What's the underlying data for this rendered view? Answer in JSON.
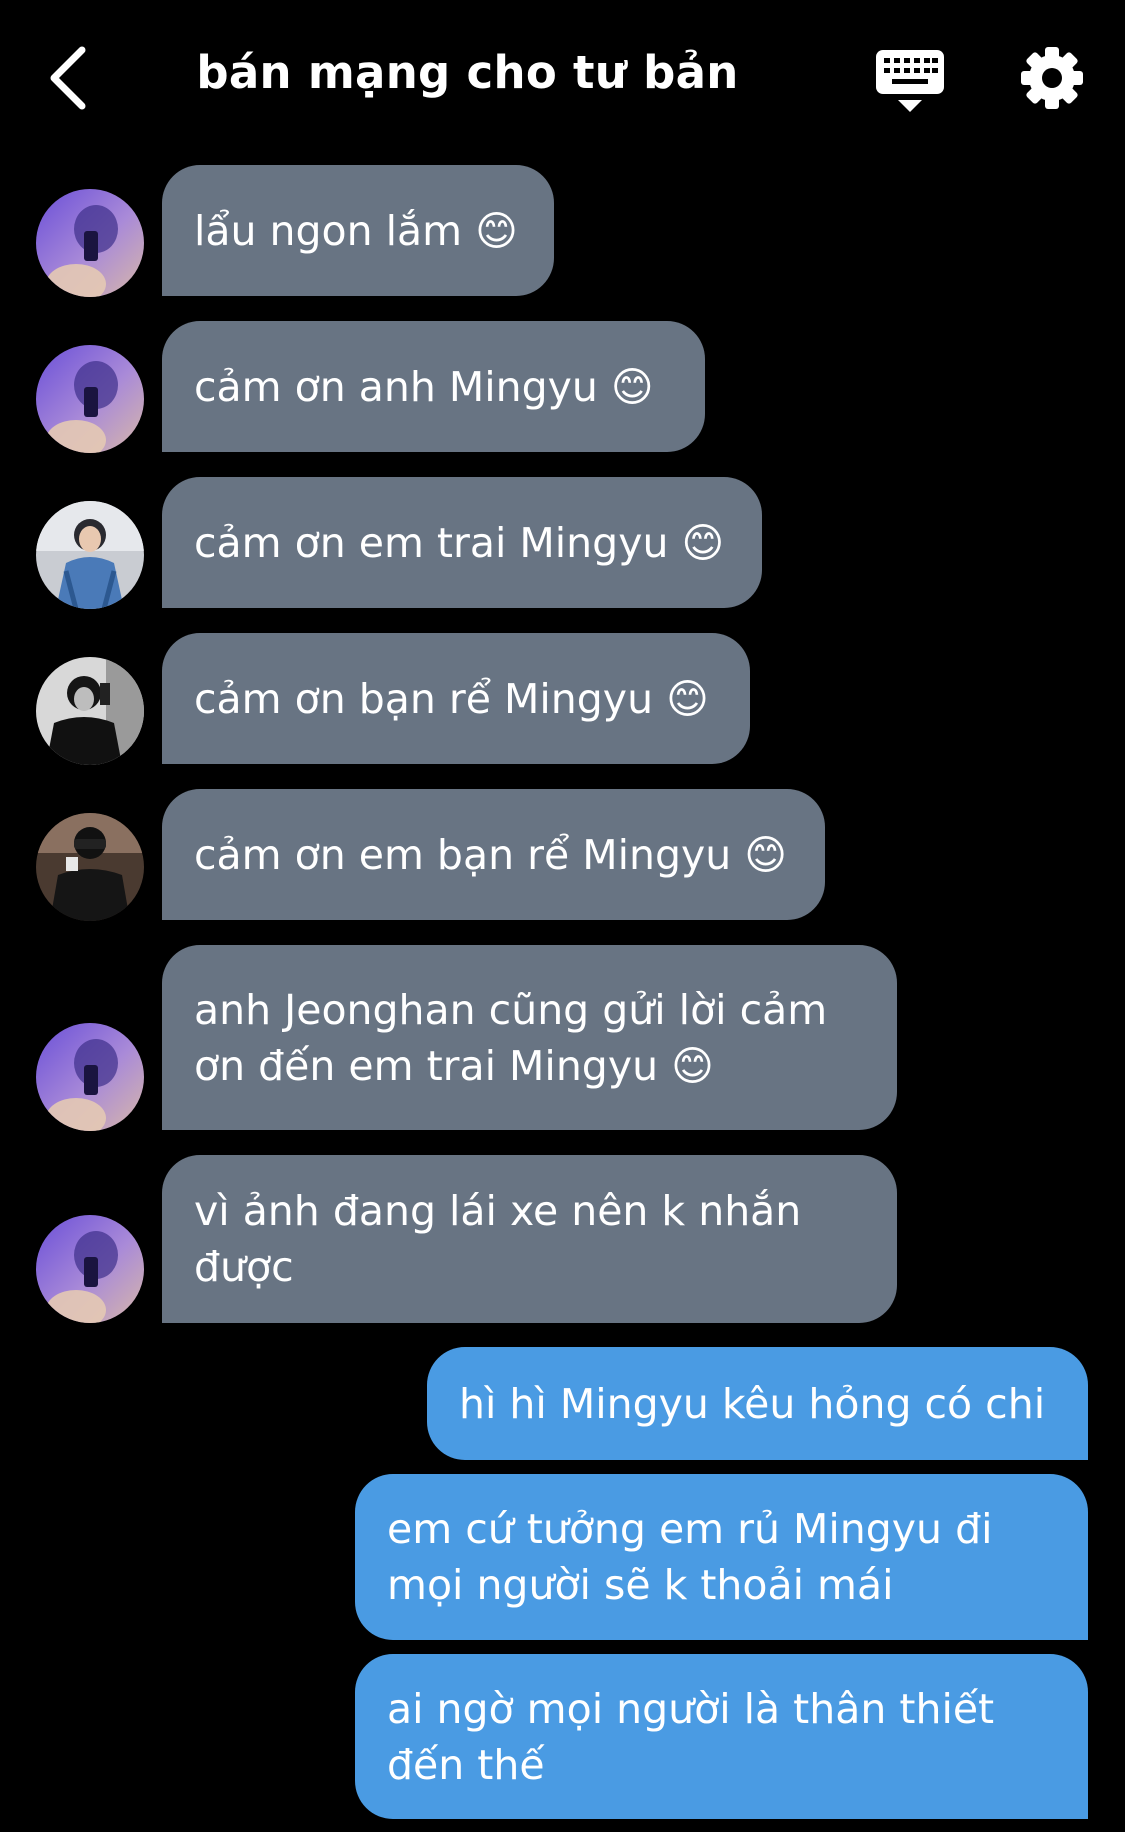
{
  "header": {
    "title": "bán mạng cho tư bản"
  },
  "colors": {
    "background": "#000000",
    "incoming_bubble": "#687483",
    "outgoing_bubble": "#4a9be3",
    "text": "#ffffff"
  },
  "icons": {
    "back": "chevron-left-icon",
    "keyboard": "keyboard-icon",
    "settings": "gear-icon"
  },
  "messages": [
    {
      "direction": "in",
      "avatar": "purple",
      "text": "lẩu ngon lắm 😊"
    },
    {
      "direction": "in",
      "avatar": "purple",
      "text": "cảm ơn anh Mingyu 😊"
    },
    {
      "direction": "in",
      "avatar": "blue-jacket",
      "text": "cảm ơn em trai Mingyu 😊"
    },
    {
      "direction": "in",
      "avatar": "monochrome",
      "text": "cảm ơn bạn rể Mingyu 😊"
    },
    {
      "direction": "in",
      "avatar": "dark",
      "text": "cảm ơn em bạn rể Mingyu 😊"
    },
    {
      "direction": "in",
      "avatar": "purple",
      "text": "anh Jeonghan cũng gửi lời cảm\nơn đến em trai Mingyu 😊"
    },
    {
      "direction": "in",
      "avatar": "purple",
      "text": "vì ảnh đang lái xe nên k nhắn\nđược"
    },
    {
      "direction": "out",
      "text": "hì hì Mingyu kêu hỏng có chi"
    },
    {
      "direction": "out",
      "text": "em cứ tưởng em rủ Mingyu đi\nmọi người sẽ k thoải mái"
    },
    {
      "direction": "out",
      "text": "ai ngờ mọi người là thân thiết\nđến thế"
    }
  ]
}
